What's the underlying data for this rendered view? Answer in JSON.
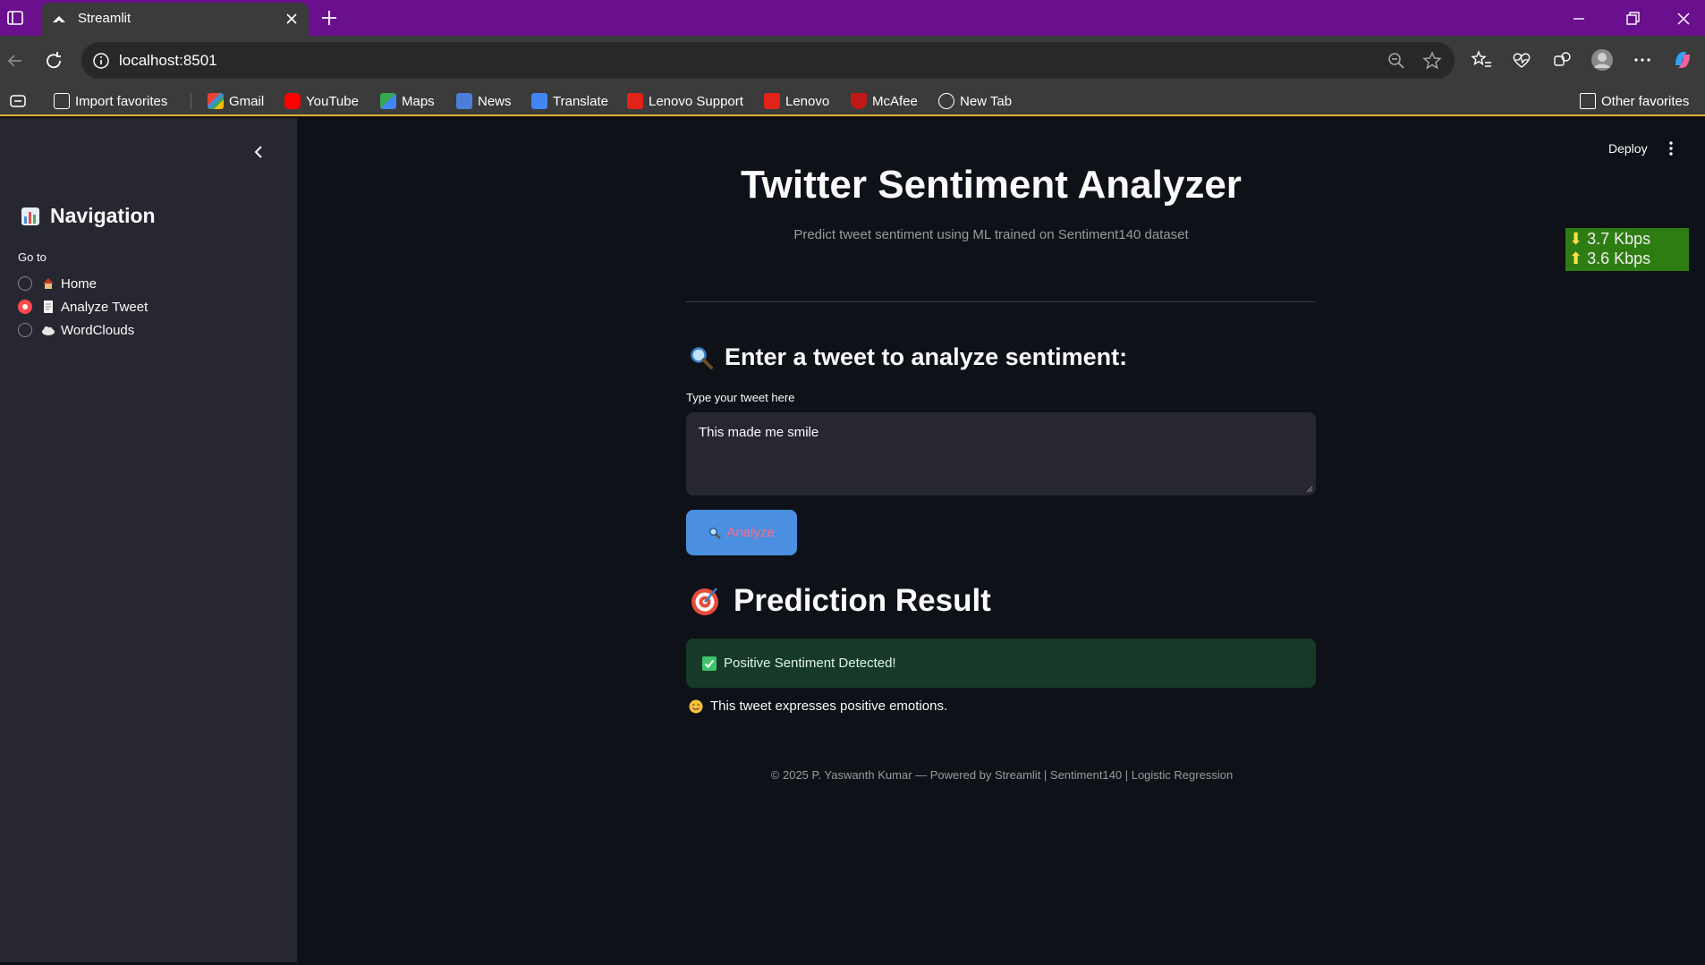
{
  "browser": {
    "tab_title": "Streamlit",
    "url": "localhost:8501",
    "bookmarks": [
      {
        "label": "Import favorites",
        "icon": "import-icon"
      },
      {
        "label": "Gmail",
        "icon": "gmail-icon"
      },
      {
        "label": "YouTube",
        "icon": "youtube-icon"
      },
      {
        "label": "Maps",
        "icon": "maps-icon"
      },
      {
        "label": "News",
        "icon": "news-icon"
      },
      {
        "label": "Translate",
        "icon": "translate-icon"
      },
      {
        "label": "Lenovo Support",
        "icon": "lenovo-icon"
      },
      {
        "label": "Lenovo",
        "icon": "lenovo-icon"
      },
      {
        "label": "McAfee",
        "icon": "mcafee-icon"
      },
      {
        "label": "New Tab",
        "icon": "globe-icon"
      }
    ],
    "other_favorites": "Other favorites"
  },
  "sidebar": {
    "title": "Navigation",
    "radio_label": "Go to",
    "options": [
      {
        "label": "Home",
        "selected": false
      },
      {
        "label": "Analyze Tweet",
        "selected": true
      },
      {
        "label": "WordClouds",
        "selected": false
      }
    ]
  },
  "toolbar": {
    "deploy": "Deploy"
  },
  "speed_meter": {
    "down": "3.7 Kbps",
    "up": "3.6 Kbps"
  },
  "main": {
    "title": "Twitter Sentiment Analyzer",
    "subtitle": "Predict tweet sentiment using ML trained on Sentiment140 dataset",
    "input_heading": "Enter a tweet to analyze sentiment:",
    "input_label": "Type your tweet here",
    "input_value": "This made me smile",
    "analyze_label": "Analyze",
    "result_heading": "Prediction Result",
    "result_alert": "Positive Sentiment Detected!",
    "result_info": "This tweet expresses positive emotions.",
    "footer": "© 2025 P. Yaswanth Kumar — Powered by Streamlit | Sentiment140 | Logistic Regression"
  },
  "colors": {
    "accent": "#ff4b4b",
    "button": "#4a8fe0",
    "success_bg": "#173a28",
    "titlebar": "#6a0f8e"
  }
}
